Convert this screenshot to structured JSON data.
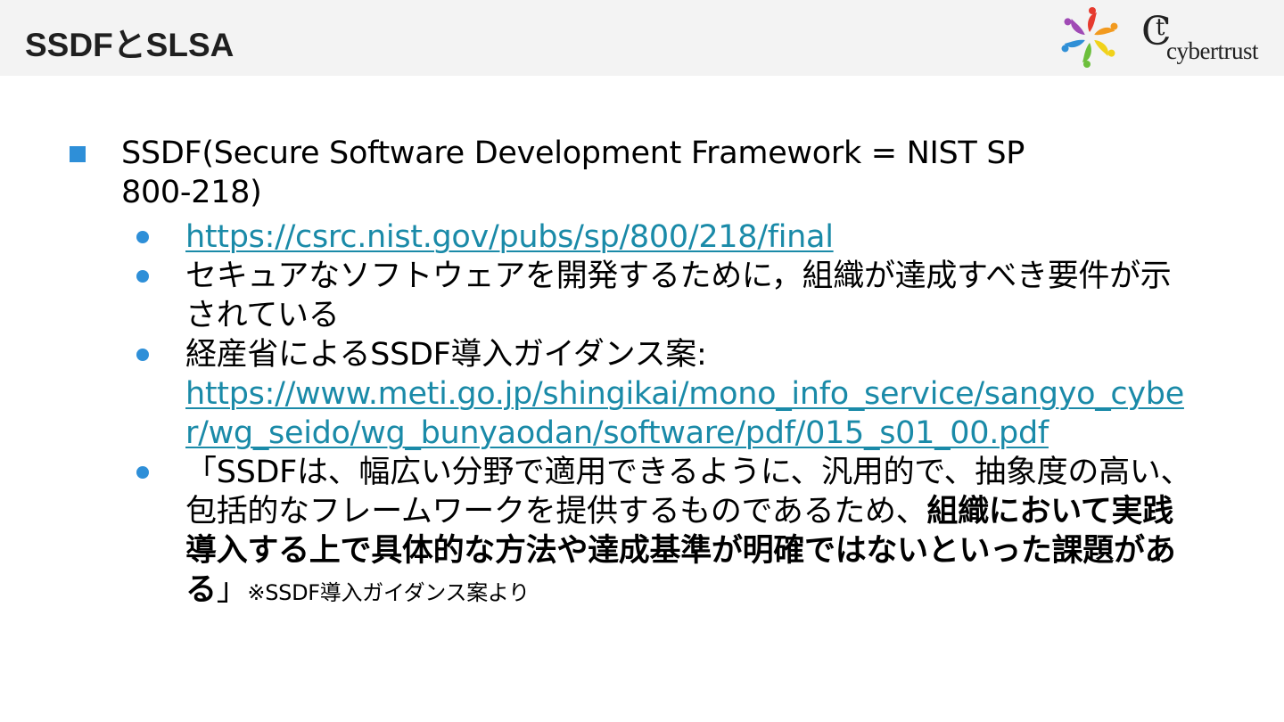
{
  "header": {
    "title": "SSDFとSLSA",
    "brand_name": "cybertrust",
    "brand_mark": "ct"
  },
  "main": {
    "heading": "SSDF(Secure Software Development Framework = NIST SP 800-218)",
    "bullets": [
      {
        "link": "https://csrc.nist.gov/pubs/sp/800/218/final"
      },
      {
        "text": "セキュアなソフトウェアを開発するために，組織が達成すべき要件が示されている"
      },
      {
        "text": "経産省によるSSDF導入ガイダンス案:",
        "link": "https://www.meti.go.jp/shingikai/mono_info_service/sangyo_cyber/wg_seido/wg_bunyaodan/software/pdf/015_s01_00.pdf"
      },
      {
        "quote_open": "「SSDFは、幅広い分野で適用できるように、汎用的で、抽象度の高い、包括的なフレームワークを提供するものであるため、",
        "quote_bold": "組織において実践導入する上で具体的な方法や達成基準が明確ではないといった課題がある",
        "quote_close": "」",
        "source": "※SSDF導入ガイダンス案より"
      }
    ]
  },
  "colors": {
    "accent": "#2e8fd8",
    "link": "#1a8aa8",
    "header_bg": "#f3f3f3"
  },
  "icons": [
    "pinwheel-logo-icon",
    "square-bullet-icon",
    "round-bullet-icon"
  ]
}
